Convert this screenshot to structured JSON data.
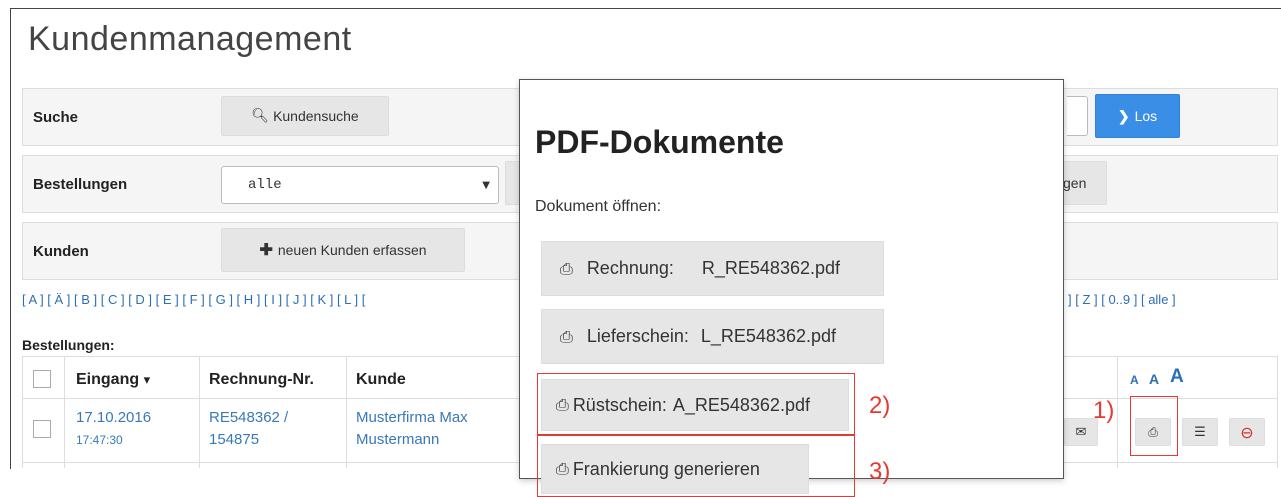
{
  "page_title": "Kundenmanagement",
  "search": {
    "label": "Suche",
    "button": "Kundensuche",
    "go_button": "Los"
  },
  "orders": {
    "label": "Bestellungen",
    "select_value": "alle",
    "trailing_button": "gen"
  },
  "customers": {
    "label": "Kunden",
    "new_button": "neuen Kunden erfassen"
  },
  "alphabet": {
    "left": "[ A ] [ Ä ] [ B ] [ C ] [ D ] [ E ] [ F ] [ G ] [ H ] [ I ] [ J ] [ K ] [ L ] [",
    "right": "] [ Z ] [ 0..9 ] [ alle ]"
  },
  "table": {
    "heading": "Bestellungen:",
    "columns": [
      "Eingang",
      "Rechnung-Nr.",
      "Kunde"
    ],
    "sort_indicator": "▾",
    "size_controls": [
      "A",
      "A",
      "A"
    ],
    "rows": [
      {
        "date": "17.10.2016",
        "time": "17:47:30",
        "invoice_line1": "RE548362 /",
        "invoice_line2": "154875",
        "customer_line1": "Musterfirma Max",
        "customer_line2": "Mustermann"
      }
    ]
  },
  "modal": {
    "title": "PDF-Dokumente",
    "subtitle": "Dokument öffnen:",
    "documents": [
      {
        "label": "Rechnung:",
        "file": "R_RE548362.pdf"
      },
      {
        "label": "Lieferschein:",
        "file": "L_RE548362.pdf"
      },
      {
        "label": "Rüstschein:",
        "file": "A_RE548362.pdf"
      },
      {
        "label": "Frankierung generieren",
        "file": ""
      }
    ]
  },
  "annotations": {
    "one": "1)",
    "two": "2)",
    "three": "3)"
  },
  "colors": {
    "primary": "#3a8ee6",
    "link": "#2c6fb5",
    "annotation": "#e53935"
  }
}
